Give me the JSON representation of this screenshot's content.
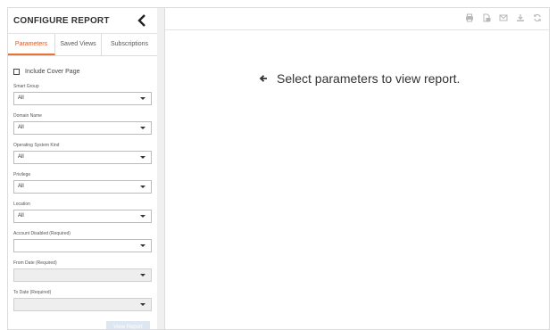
{
  "sidebar": {
    "title": "CONFIGURE REPORT",
    "tabs": [
      {
        "label": "Parameters"
      },
      {
        "label": "Saved Views"
      },
      {
        "label": "Subscriptions"
      }
    ],
    "active_tab": "Parameters",
    "include_cover_page": {
      "label": "Include Cover Page",
      "checked": false
    },
    "fields": [
      {
        "label": "Smart Group",
        "value": "All"
      },
      {
        "label": "Domain Name",
        "value": "All"
      },
      {
        "label": "Operating System Kind",
        "value": "All"
      },
      {
        "label": "Privilege",
        "value": "All"
      },
      {
        "label": "Location",
        "value": "All"
      },
      {
        "label": "Account Disabled (Required)",
        "value": ""
      },
      {
        "label": "From Date (Required)",
        "value": ""
      },
      {
        "label": "To Date (Required)",
        "value": ""
      }
    ],
    "view_button_label": "View Report"
  },
  "main": {
    "message": "Select parameters to view report."
  },
  "icons": [
    "print-icon",
    "export-pdf-icon",
    "email-icon",
    "download-icon",
    "refresh-icon"
  ],
  "colors": {
    "accent": "#e8722f",
    "button_disabled": "#dce7f2",
    "icon_grey": "#b8b8b8"
  }
}
